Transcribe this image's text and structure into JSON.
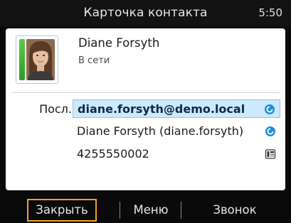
{
  "header": {
    "title": "Карточка контакта",
    "time": "5:50"
  },
  "contact": {
    "name": "Diane Forsyth",
    "status": "В сети",
    "presence_color": "#3cb034"
  },
  "details": {
    "label": "Посл.",
    "items": [
      {
        "text": "diane.forsyth@demo.local",
        "icon": "im-chat-icon",
        "selected": true
      },
      {
        "text": "Diane Forsyth (diane.forsyth)",
        "icon": "im-chat-icon",
        "selected": false
      },
      {
        "text": "4255550002",
        "icon": "desk-phone-icon",
        "selected": false
      }
    ]
  },
  "softkeys": {
    "close": "Закрыть",
    "menu": "Меню",
    "call": "Звонок"
  },
  "colors": {
    "accent_focus": "#f2a21a",
    "selection": "#cde9fb",
    "background": "#0a0a0a"
  }
}
